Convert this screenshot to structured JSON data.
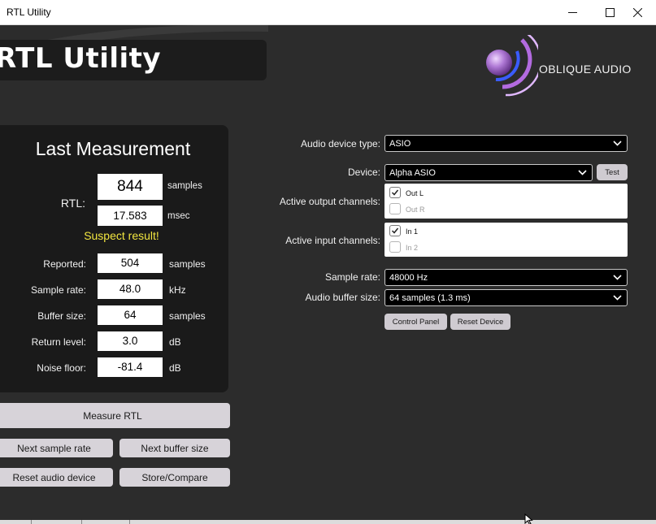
{
  "window": {
    "title": "RTL Utility"
  },
  "banner": {
    "title": "RTL Utility"
  },
  "brand": {
    "name": "OBLIQUE AUDIO",
    "accent": "#b36be0"
  },
  "measurement": {
    "title": "Last Measurement",
    "rtl": {
      "label": "RTL:",
      "samples": "844",
      "samples_unit": "samples",
      "msec": "17.583",
      "msec_unit": "msec"
    },
    "warning": "Suspect result!",
    "rows": [
      {
        "label": "Reported:",
        "value": "504",
        "unit": "samples"
      },
      {
        "label": "Sample rate:",
        "value": "48.0",
        "unit": "kHz"
      },
      {
        "label": "Buffer size:",
        "value": "64",
        "unit": "samples"
      },
      {
        "label": "Return level:",
        "value": "3.0",
        "unit": "dB"
      },
      {
        "label": "Noise floor:",
        "value": "-81.4",
        "unit": "dB"
      }
    ]
  },
  "actions": {
    "measure": "Measure RTL",
    "next_sample_rate": "Next sample rate",
    "next_buffer_size": "Next buffer size",
    "reset_audio_device": "Reset audio device",
    "store_compare": "Store/Compare"
  },
  "settings": {
    "device_type": {
      "label": "Audio device type:",
      "value": "ASIO"
    },
    "device": {
      "label": "Device:",
      "value": "Alpha ASIO",
      "test_label": "Test"
    },
    "output_channels": {
      "label": "Active output channels:",
      "items": [
        {
          "name": "Out L",
          "checked": true
        },
        {
          "name": "Out R",
          "checked": false
        }
      ]
    },
    "input_channels": {
      "label": "Active input channels:",
      "items": [
        {
          "name": "In 1",
          "checked": true
        },
        {
          "name": "In 2",
          "checked": false
        }
      ]
    },
    "sample_rate": {
      "label": "Sample rate:",
      "value": "48000 Hz"
    },
    "buffer_size": {
      "label": "Audio buffer size:",
      "value": "64 samples (1.3 ms)"
    },
    "control_panel": "Control Panel",
    "reset_device": "Reset Device"
  }
}
